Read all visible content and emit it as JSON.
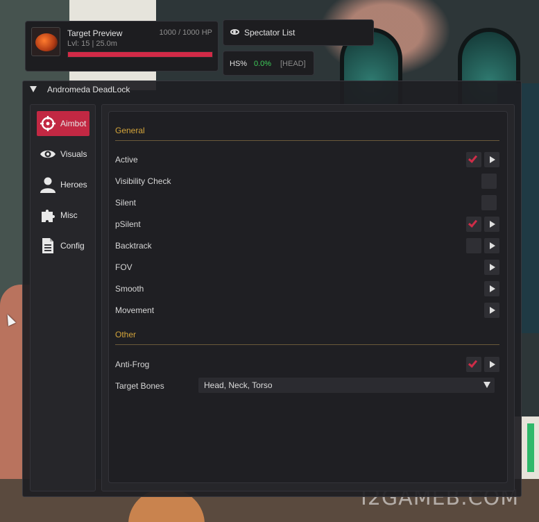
{
  "target_preview": {
    "name": "Target Preview",
    "hp": "1000 / 1000 HP",
    "level_distance": "Lvl: 15 | 25.0m",
    "hp_fraction": 1.0
  },
  "spectator": {
    "label": "Spectator List",
    "icon": "eye-icon"
  },
  "hs": {
    "label": "HS%",
    "value": "0.0%",
    "bone": "[HEAD]"
  },
  "window": {
    "title": "Andromeda DeadLock"
  },
  "sidebar": {
    "items": [
      {
        "label": "Aimbot",
        "icon": "crosshair-icon",
        "active": true
      },
      {
        "label": "Visuals",
        "icon": "eye-icon",
        "active": false
      },
      {
        "label": "Heroes",
        "icon": "person-icon",
        "active": false
      },
      {
        "label": "Misc",
        "icon": "puzzle-icon",
        "active": false
      },
      {
        "label": "Config",
        "icon": "document-icon",
        "active": false
      }
    ]
  },
  "general": {
    "title": "General",
    "rows": [
      {
        "label": "Active",
        "checked": true
      },
      {
        "label": "Visibility Check",
        "checked": false
      },
      {
        "label": "Silent",
        "checked": false
      },
      {
        "label": "pSilent",
        "checked": true
      },
      {
        "label": "Backtrack",
        "checked": false
      },
      {
        "label": "FOV"
      },
      {
        "label": "Smooth"
      },
      {
        "label": "Movement"
      }
    ]
  },
  "other": {
    "title": "Other",
    "anti_frog": {
      "label": "Anti-Frog",
      "checked": true
    },
    "target_bones": {
      "label": "Target Bones",
      "value": "Head, Neck, Torso"
    }
  },
  "watermark": "I2GAMEB.COM",
  "colors": {
    "accent": "#c22843",
    "section": "#d4a53b",
    "hs_value": "#3ecf5a"
  }
}
